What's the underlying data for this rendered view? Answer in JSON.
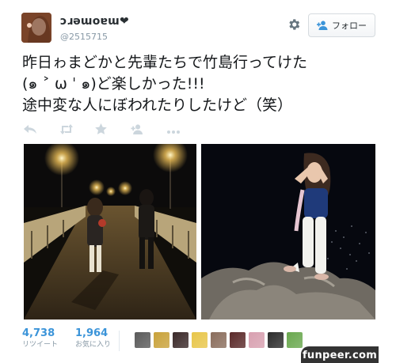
{
  "author": {
    "display_name": "ɔɹəɯoɐɯ❤",
    "screen_name": "@2515715"
  },
  "header": {
    "settings_icon": "gear-icon",
    "follow_label": "フォロー",
    "follow_icon": "person-add-icon"
  },
  "tweet": {
    "lines": [
      "昨日ゎまどかと先輩たちで竹島行ってけた",
      "(๑ ˃ ω ˈ ๑)ど楽しかった!!!",
      "途中変な人にぼわれたりしたけど（笑）"
    ]
  },
  "actions": [
    "reply-icon",
    "retweet-icon",
    "favorite-icon",
    "follow-icon",
    "more-icon"
  ],
  "photos": [
    {
      "name": "bridge-night-photo"
    },
    {
      "name": "rocks-night-photo"
    }
  ],
  "stats": {
    "retweets": {
      "value": "4,738",
      "label": "リツイート"
    },
    "favorites": {
      "value": "1,964",
      "label": "お気に入り"
    }
  },
  "favoriters": {
    "colors": [
      "#5a5a5a",
      "#c9a23a",
      "#3b2a2a",
      "#e8c64a",
      "#8a6d5c",
      "#5b2a2a",
      "#d8a0b0",
      "#2b2b2b",
      "#6aa84f"
    ]
  },
  "watermark": "funpeer.com",
  "colors": {
    "accent": "#3b94d9",
    "muted": "#8899a6",
    "text": "#14171a"
  }
}
